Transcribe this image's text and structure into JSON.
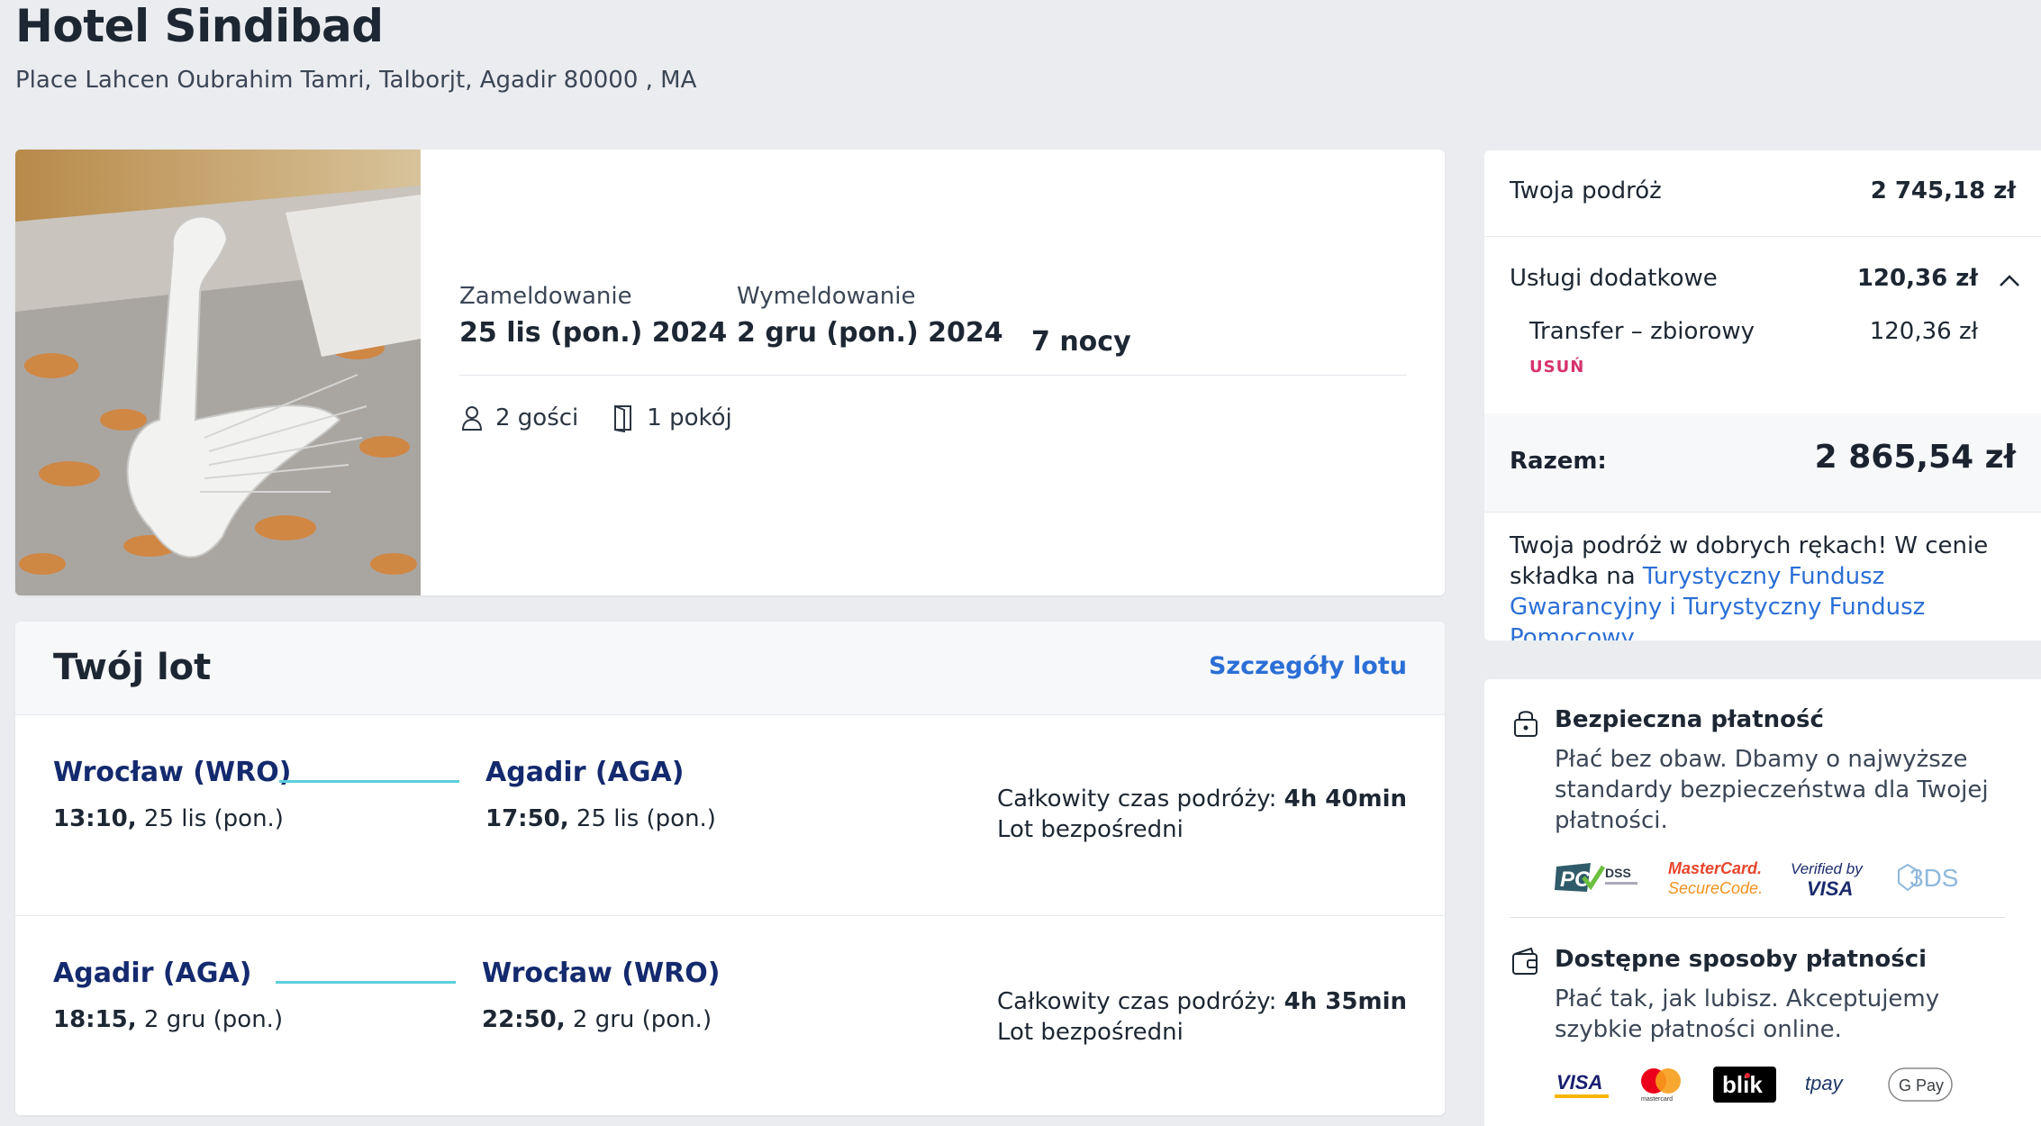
{
  "hotel": {
    "name": "Hotel Sindibad",
    "address": "Place Lahcen Oubrahim Tamri, Talborjt, Agadir 80000 , MA"
  },
  "stay": {
    "checkin_label": "Zameldowanie",
    "checkin_value": "25 lis (pon.) 2024",
    "checkout_label": "Wymeldowanie",
    "checkout_value": "2 gru (pon.) 2024",
    "nights": "7 nocy",
    "guests": "2 gości",
    "rooms": "1 pokój"
  },
  "flight": {
    "title": "Twój lot",
    "details_link": "Szczegóły lotu",
    "legs": [
      {
        "from_city": "Wrocław (WRO)",
        "from_time": "13:10,",
        "from_date": "25 lis (pon.)",
        "to_city": "Agadir (AGA)",
        "to_time": "17:50,",
        "to_date": "25 lis (pon.)",
        "duration_label": "Całkowity czas podróży:",
        "duration_value": "4h 40min",
        "type": "Lot bezpośredni"
      },
      {
        "from_city": "Agadir (AGA)",
        "from_time": "18:15,",
        "from_date": "2 gru (pon.)",
        "to_city": "Wrocław (WRO)",
        "to_time": "22:50,",
        "to_date": "2 gru (pon.)",
        "duration_label": "Całkowity czas podróży:",
        "duration_value": "4h 35min",
        "type": "Lot bezpośredni"
      }
    ]
  },
  "summary": {
    "trip_label": "Twoja podróż",
    "trip_value": "2 745,18 zł",
    "extras_label": "Usługi dodatkowe",
    "extras_value": "120,36 zł",
    "transfer_label": "Transfer – zbiorowy",
    "transfer_value": "120,36 zł",
    "remove_label": "USUŃ",
    "total_label": "Razem:",
    "total_value": "2 865,54 zł",
    "trust_text": "Twoja podróż w dobrych rękach! W cenie składka na ",
    "trust_link": "Turystyczny Fundusz Gwarancyjny i Turystyczny Fundusz Pomocowy"
  },
  "payment": {
    "secure_title": "Bezpieczna płatność",
    "secure_text": "Płać bez obaw. Dbamy o najwyższe standardy bezpieczeństwa dla Twojej płatności.",
    "methods_title": "Dostępne sposoby płatności",
    "methods_text": "Płać tak, jak lubisz. Akceptujemy szybkie płatności online.",
    "security_logos": {
      "pci": "PCI",
      "dss": "DSS",
      "mastercard_securecode": [
        "MasterCard.",
        "SecureCode."
      ],
      "verified_by_visa": [
        "Verified by",
        "VISA"
      ],
      "three_ds": "3DS"
    },
    "method_logos": {
      "visa": "VISA",
      "mastercard": "mastercard",
      "blik": "blik",
      "tpay": "tpay",
      "gpay": "G Pay"
    }
  },
  "colors": {
    "accent_link": "#2b6fd6",
    "city_navy": "#142a6e",
    "route_line": "#5ccfdc",
    "remove_pink": "#d6326e",
    "page_bg": "#ebecef"
  }
}
